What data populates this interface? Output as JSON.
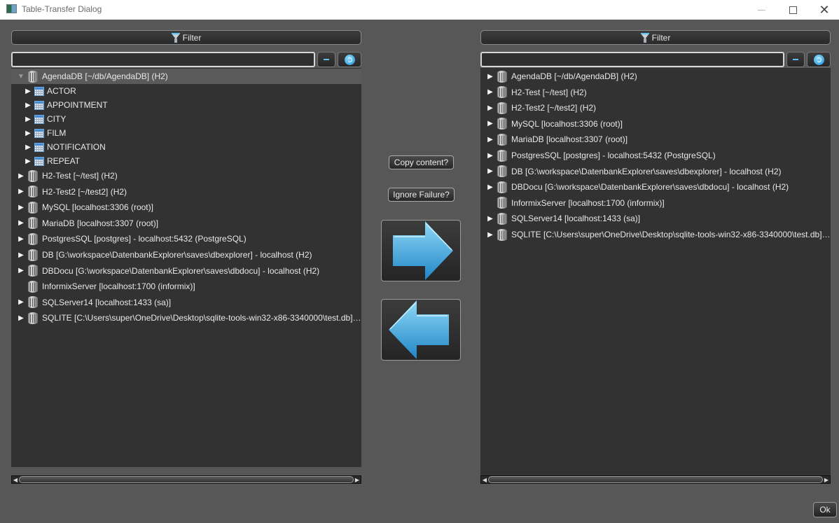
{
  "window": {
    "title": "Table-Transfer Dialog",
    "icon": "app-window-icon",
    "controls": [
      "minimize",
      "maximize",
      "close"
    ]
  },
  "left_panel": {
    "filter_label": "Filter",
    "search_value": "",
    "tree": [
      {
        "label": "AgendaDB [~/db/AgendaDB] (H2)",
        "type": "db",
        "expanded": true,
        "selected": true,
        "level": 0
      },
      {
        "label": "ACTOR",
        "type": "table",
        "level": 1
      },
      {
        "label": "APPOINTMENT",
        "type": "table",
        "level": 1
      },
      {
        "label": "CITY",
        "type": "table",
        "level": 1
      },
      {
        "label": "FILM",
        "type": "table",
        "level": 1
      },
      {
        "label": "NOTIFICATION",
        "type": "table",
        "level": 1
      },
      {
        "label": "REPEAT",
        "type": "table",
        "level": 1
      },
      {
        "label": "H2-Test [~/test] (H2)",
        "type": "db",
        "level": 0
      },
      {
        "label": "H2-Test2 [~/test2] (H2)",
        "type": "db",
        "level": 0
      },
      {
        "label": "MySQL [localhost:3306 (root)]",
        "type": "db",
        "level": 0
      },
      {
        "label": "MariaDB [localhost:3307 (root)]",
        "type": "db",
        "level": 0
      },
      {
        "label": "PostgresSQL [postgres] - localhost:5432 (PostgreSQL)",
        "type": "db",
        "level": 0
      },
      {
        "label": "DB [G:\\workspace\\DatenbankExplorer\\saves\\dbexplorer] - localhost (H2)",
        "type": "db",
        "level": 0
      },
      {
        "label": "DBDocu [G:\\workspace\\DatenbankExplorer\\saves\\dbdocu] - localhost (H2)",
        "type": "db",
        "level": 0
      },
      {
        "label": "InformixServer [localhost:1700 (informix)]",
        "type": "db",
        "level": 0,
        "no_arrow": true
      },
      {
        "label": "SQLServer14 [localhost:1433 (sa)]",
        "type": "db",
        "level": 0
      },
      {
        "label": "SQLITE [C:\\Users\\super\\OneDrive\\Desktop\\sqlite-tools-win32-x86-3340000\\test.db] (SQLi...",
        "type": "db",
        "level": 0
      }
    ]
  },
  "right_panel": {
    "filter_label": "Filter",
    "search_value": "",
    "tree": [
      {
        "label": "AgendaDB [~/db/AgendaDB] (H2)",
        "type": "db",
        "level": 0
      },
      {
        "label": "H2-Test [~/test] (H2)",
        "type": "db",
        "level": 0
      },
      {
        "label": "H2-Test2 [~/test2] (H2)",
        "type": "db",
        "level": 0
      },
      {
        "label": "MySQL [localhost:3306 (root)]",
        "type": "db",
        "level": 0
      },
      {
        "label": "MariaDB [localhost:3307 (root)]",
        "type": "db",
        "level": 0
      },
      {
        "label": "PostgresSQL [postgres] - localhost:5432 (PostgreSQL)",
        "type": "db",
        "level": 0
      },
      {
        "label": "DB [G:\\workspace\\DatenbankExplorer\\saves\\dbexplorer] - localhost (H2)",
        "type": "db",
        "level": 0
      },
      {
        "label": "DBDocu [G:\\workspace\\DatenbankExplorer\\saves\\dbdocu] - localhost (H2)",
        "type": "db",
        "level": 0
      },
      {
        "label": "InformixServer [localhost:1700 (informix)]",
        "type": "db",
        "level": 0,
        "no_arrow": true
      },
      {
        "label": "SQLServer14 [localhost:1433 (sa)]",
        "type": "db",
        "level": 0
      },
      {
        "label": "SQLITE [C:\\Users\\super\\OneDrive\\Desktop\\sqlite-tools-win32-x86-3340000\\test.db] (SQLi...",
        "type": "db",
        "level": 0
      }
    ]
  },
  "center": {
    "copy_content_label": "Copy content?",
    "ignore_failure_label": "Ignore Failure?",
    "transfer_right_icon": "arrow-right-icon",
    "transfer_left_icon": "arrow-left-icon"
  },
  "footer": {
    "ok_label": "Ok"
  },
  "colors": {
    "background": "#575757",
    "tree_background": "#323232",
    "selected_row": "#5a5a5a",
    "accent": "#5fc1f0",
    "arrow_blue": "#3aa8e0"
  }
}
